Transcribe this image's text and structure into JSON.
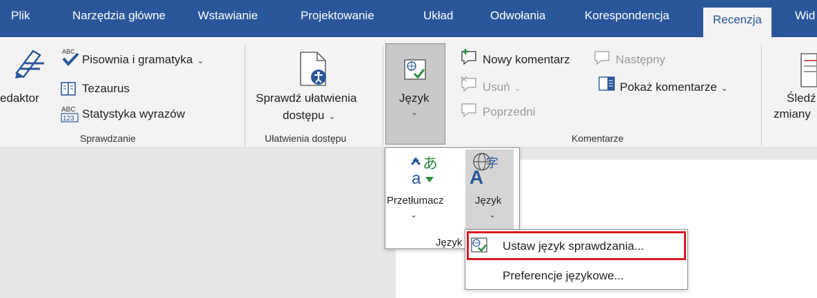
{
  "tabs": [
    "Plik",
    "Narzędzia główne",
    "Wstawianie",
    "Projektowanie",
    "Układ",
    "Odwołania",
    "Korespondencja",
    "Recenzja",
    "Wid"
  ],
  "colors": {
    "brand": "#2b579a",
    "highlight": "#d7191e",
    "selected": "#c9c9c9"
  },
  "ribbon": {
    "editor_label": "edaktor",
    "spelling": "Pisownia i gramatyka",
    "thesaurus": "Tezaurus",
    "wordcount": "Statystyka wyrazów",
    "group_proofing": "Sprawdzanie",
    "accessibility_line1": "Sprawdź ułatwienia",
    "accessibility_line2": "dostępu",
    "group_accessibility": "Ułatwienia dostępu",
    "language": "Język",
    "new_comment": "Nowy komentarz",
    "next": "Następny",
    "delete": "Usuń",
    "previous": "Poprzedni",
    "show_comments": "Pokaż komentarze",
    "group_comments": "Komentarze",
    "track_line1": "Śledź",
    "track_line2": "zmiany"
  },
  "popup": {
    "translate": "Przetłumacz",
    "language": "Język",
    "group": "Język"
  },
  "menu": {
    "set_proofing": "Ustaw język sprawdzania...",
    "preferences": "Preferencje językowe..."
  },
  "icons": [
    "pen-icon",
    "spellcheck-icon",
    "book-icon",
    "abc123-icon",
    "accessibility-icon",
    "language-icon",
    "new-comment-icon",
    "next-comment-icon",
    "delete-comment-icon",
    "previous-comment-icon",
    "show-comments-icon",
    "track-changes-icon",
    "translate-icon",
    "language-a-icon",
    "chevron-down-icon"
  ]
}
